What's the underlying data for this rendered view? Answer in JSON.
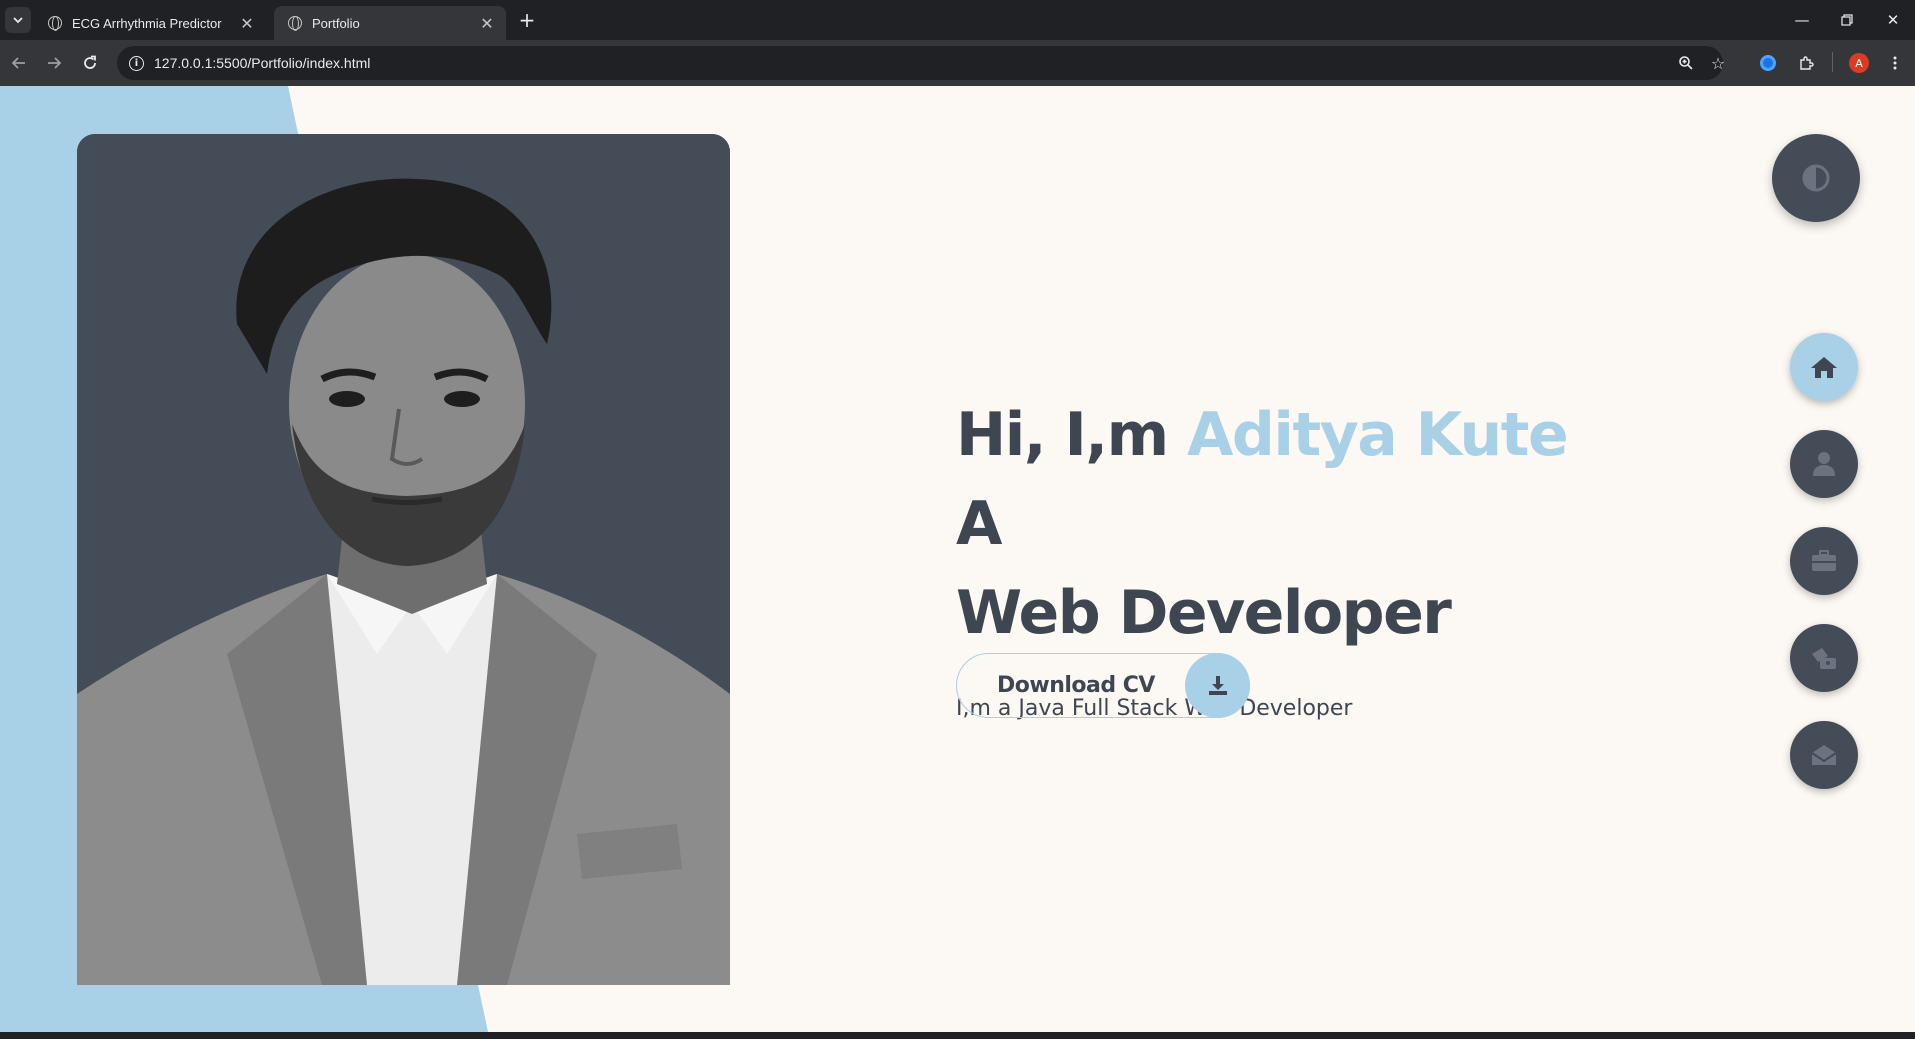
{
  "browser": {
    "tabs": [
      {
        "title": "ECG Arrhythmia Predictor",
        "active": false
      },
      {
        "title": "Portfolio",
        "active": true
      }
    ],
    "url": "127.0.0.1:5500/Portfolio/index.html",
    "profile_initial": "A"
  },
  "hero": {
    "greeting": "Hi, I,m ",
    "name": "Aditya Kute",
    "role_a": " A",
    "role_line2": "Web Developer",
    "subtitle": "I,m a Java Full Stack Web Developer",
    "cta_label": "Download CV"
  },
  "nav": {
    "items": [
      {
        "icon": "home-icon",
        "active": true
      },
      {
        "icon": "user-icon",
        "active": false
      },
      {
        "icon": "briefcase-icon",
        "active": false
      },
      {
        "icon": "blog-icon",
        "active": false
      },
      {
        "icon": "mail-icon",
        "active": false
      }
    ]
  },
  "colors": {
    "accent": "#a8d0e6",
    "dark": "#444c57",
    "text": "#3e4651",
    "page_bg": "#fcf8f3"
  }
}
